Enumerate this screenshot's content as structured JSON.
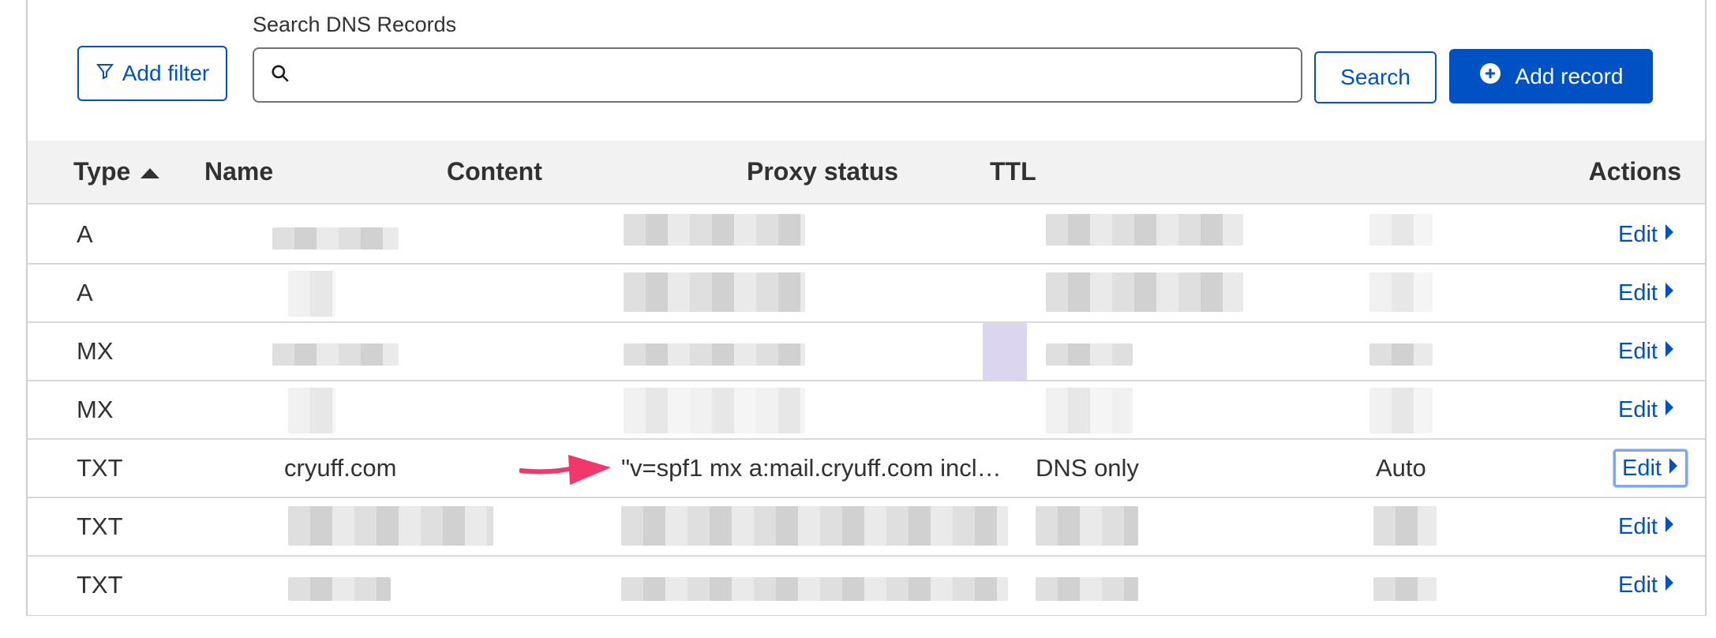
{
  "toolbar": {
    "add_filter_label": "Add filter",
    "search_label": "Search DNS Records",
    "search_value": "",
    "search_placeholder": "",
    "search_button_label": "Search",
    "add_record_label": "Add record"
  },
  "table": {
    "headers": {
      "type": "Type",
      "name": "Name",
      "content": "Content",
      "proxy_status": "Proxy status",
      "ttl": "TTL",
      "actions": "Actions"
    },
    "sort": {
      "column": "Type",
      "direction": "ascending"
    },
    "rows": [
      {
        "type": "A",
        "name": "",
        "content": "",
        "proxy_status": "",
        "ttl": "",
        "action": "Edit",
        "redacted": true
      },
      {
        "type": "A",
        "name": "",
        "content": "",
        "proxy_status": "",
        "ttl": "",
        "action": "Edit",
        "redacted": true
      },
      {
        "type": "MX",
        "name": "",
        "content": "",
        "proxy_status": "",
        "ttl": "",
        "action": "Edit",
        "redacted": true
      },
      {
        "type": "MX",
        "name": "",
        "content": "",
        "proxy_status": "",
        "ttl": "",
        "action": "Edit",
        "redacted": true
      },
      {
        "type": "TXT",
        "name": "cryuff.com",
        "content": "\"v=spf1 mx a:mail.cryuff.com incl…",
        "proxy_status": "DNS only",
        "ttl": "Auto",
        "action": "Edit",
        "redacted": false,
        "highlighted": true
      },
      {
        "type": "TXT",
        "name": "",
        "content": "",
        "proxy_status": "",
        "ttl": "",
        "action": "Edit",
        "redacted": true
      },
      {
        "type": "TXT",
        "name": "",
        "content": "",
        "proxy_status": "",
        "ttl": "",
        "action": "Edit",
        "redacted": true
      }
    ]
  },
  "icons": {
    "filter": "filter-icon",
    "search": "search-icon",
    "add": "plus-circle-icon",
    "sort": "sort-ascending-icon",
    "edit_chevron": "caret-right-icon",
    "annotation": "arrow-annotation-icon"
  },
  "colors": {
    "accent": "#0051c3",
    "header_bg": "#f2f2f2",
    "annotation_arrow": "#f2386b"
  }
}
